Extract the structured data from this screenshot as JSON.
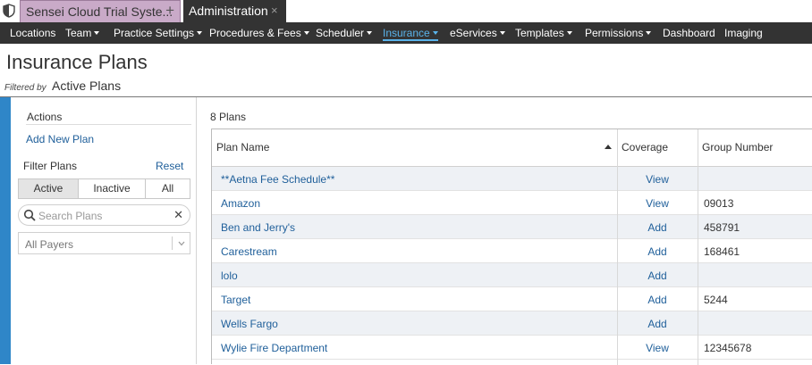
{
  "tabs": [
    {
      "label": "Sensei Cloud Trial Syste...",
      "action": "+"
    },
    {
      "label": "Administration",
      "action": "×"
    }
  ],
  "menu": [
    {
      "label": "Locations",
      "dropdown": false
    },
    {
      "label": "Team",
      "dropdown": true
    },
    {
      "label": "Practice Settings",
      "dropdown": true
    },
    {
      "label": "Procedures & Fees",
      "dropdown": true
    },
    {
      "label": "Scheduler",
      "dropdown": true
    },
    {
      "label": "Insurance",
      "dropdown": true,
      "active": true
    },
    {
      "label": "eServices",
      "dropdown": true
    },
    {
      "label": "Templates",
      "dropdown": true
    },
    {
      "label": "Permissions",
      "dropdown": true
    },
    {
      "label": "Dashboard",
      "dropdown": false
    },
    {
      "label": "Imaging",
      "dropdown": false
    }
  ],
  "page": {
    "title": "Insurance Plans",
    "filtered_by_label": "Filtered by",
    "filter_value": "Active Plans"
  },
  "sidebar": {
    "actions_title": "Actions",
    "add_new_plan": "Add New Plan",
    "filter_title": "Filter Plans",
    "reset": "Reset",
    "segments": [
      "Active",
      "Inactive",
      "All"
    ],
    "selected_segment": "Active",
    "search_placeholder": "Search Plans",
    "payers_value": "All Payers"
  },
  "table": {
    "count_label": "8 Plans",
    "columns": [
      "Plan Name",
      "Coverage",
      "Group Number"
    ],
    "sorted_column": "Plan Name",
    "sort_direction": "ascending",
    "rows": [
      {
        "plan": "**Aetna Fee Schedule**",
        "coverage": "View",
        "group": ""
      },
      {
        "plan": "Amazon",
        "coverage": "View",
        "group": "09013"
      },
      {
        "plan": "Ben and Jerry's",
        "coverage": "Add",
        "group": "458791"
      },
      {
        "plan": "Carestream",
        "coverage": "Add",
        "group": "168461"
      },
      {
        "plan": "lolo",
        "coverage": "Add",
        "group": ""
      },
      {
        "plan": "Target",
        "coverage": "Add",
        "group": "5244"
      },
      {
        "plan": "Wells Fargo",
        "coverage": "Add",
        "group": ""
      },
      {
        "plan": "Wylie Fire Department",
        "coverage": "View",
        "group": "12345678"
      }
    ]
  },
  "colors": {
    "menubar": "#333333",
    "accent": "#5ab3ea",
    "link": "#1f5f9a",
    "sidebar_stripe": "#2f86c8",
    "tab_inactive": "#c9aac8"
  }
}
